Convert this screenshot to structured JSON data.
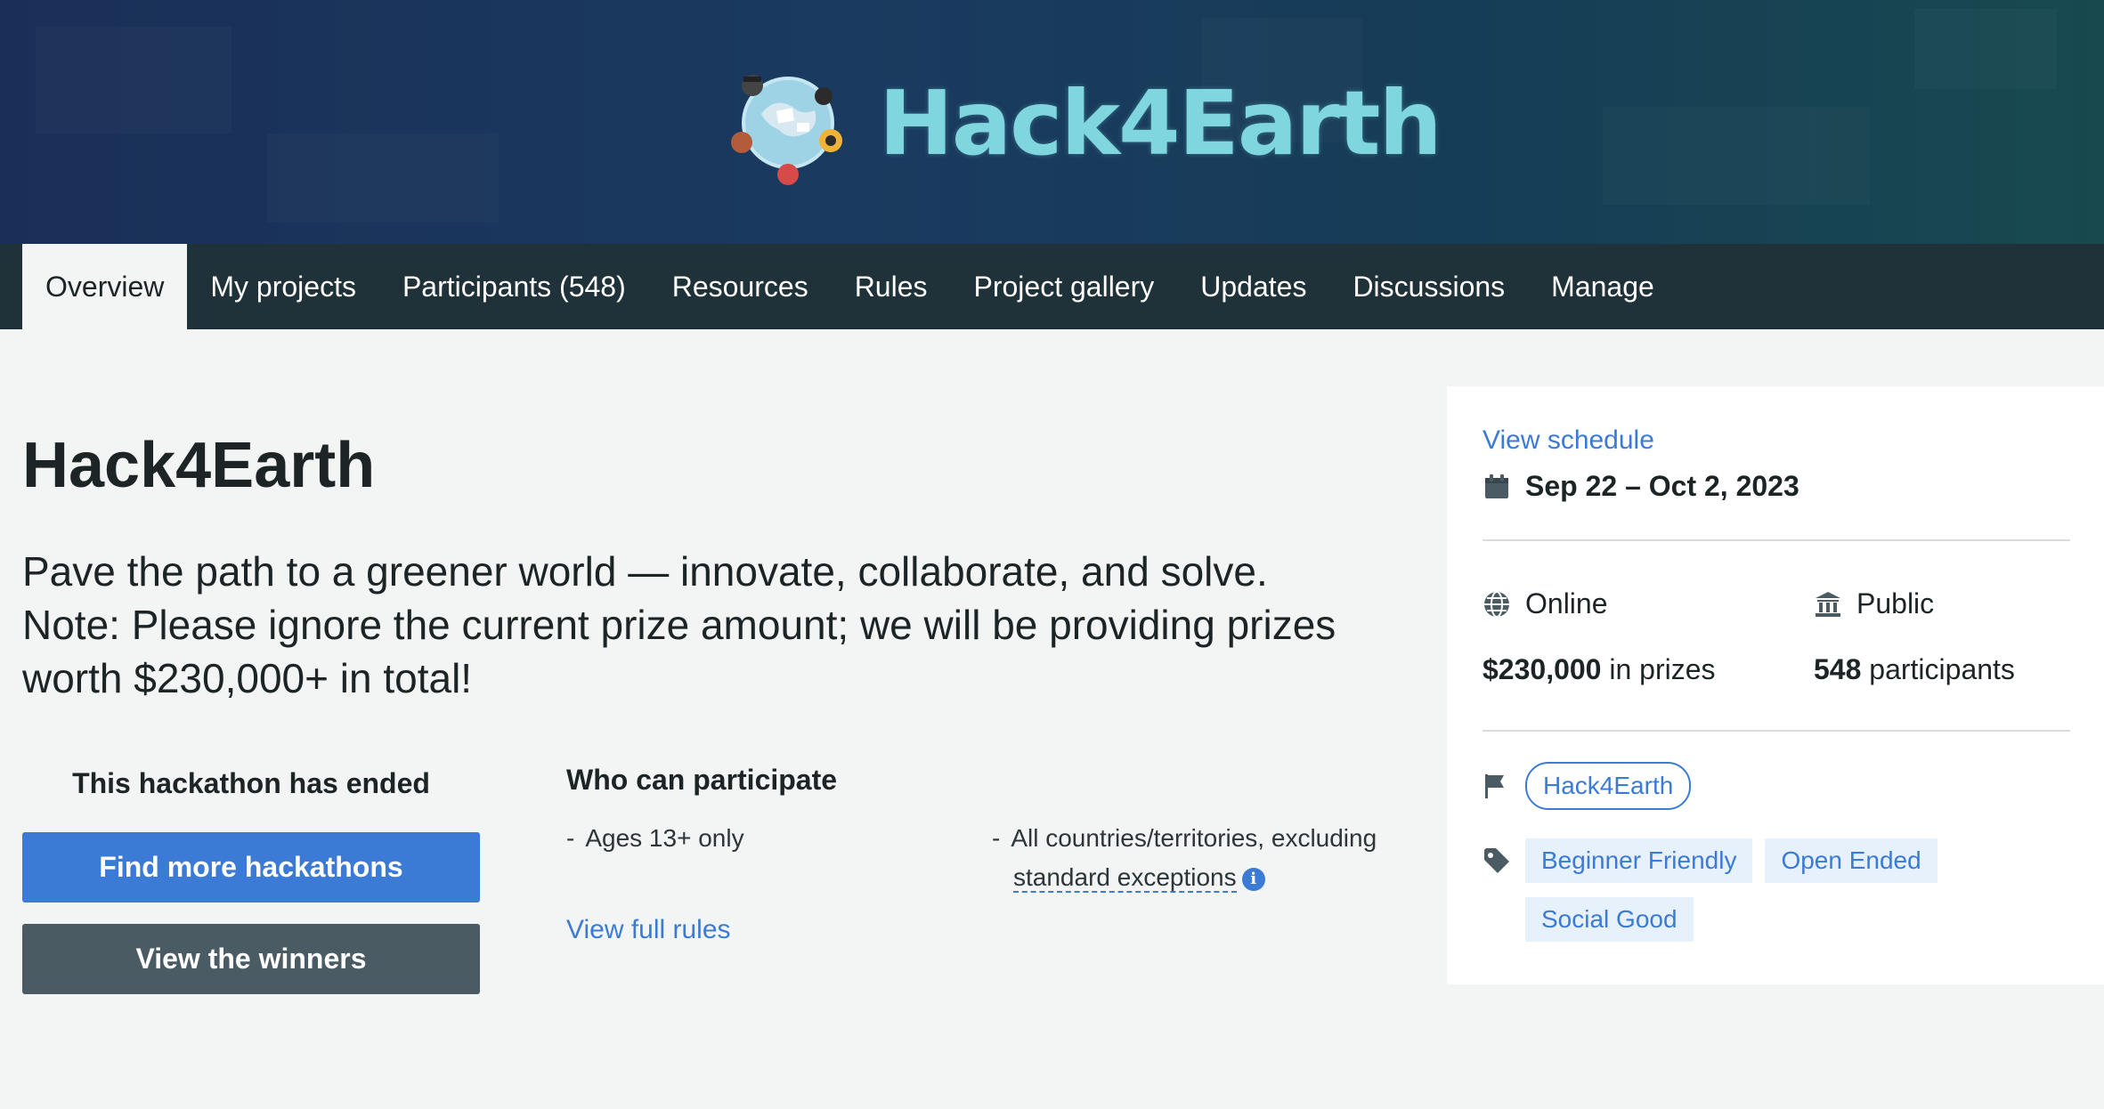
{
  "banner": {
    "logo_text": "Hack4Earth",
    "colors": {
      "background": "#1a3a5f",
      "logo_text": "#7fd6df"
    }
  },
  "nav": {
    "items": [
      {
        "label": "Overview",
        "active": true
      },
      {
        "label": "My projects"
      },
      {
        "label": "Participants (548)"
      },
      {
        "label": "Resources"
      },
      {
        "label": "Rules"
      },
      {
        "label": "Project gallery"
      },
      {
        "label": "Updates"
      },
      {
        "label": "Discussions"
      },
      {
        "label": "Manage"
      }
    ]
  },
  "main": {
    "title": "Hack4Earth",
    "tagline": "Pave the path to a greener world — innovate, collaborate, and solve. Note: Please ignore the current prize amount; we will be providing prizes worth $230,000+ in total!",
    "status": "This hackathon has ended",
    "find_button": "Find more hackathons",
    "winners_button": "View the winners",
    "who_title": "Who can participate",
    "eligibility": {
      "ages": "Ages 13+ only",
      "countries": "All countries/territories, excluding",
      "exceptions": "standard exceptions"
    },
    "rules_link": "View full rules"
  },
  "sidebar": {
    "schedule_link": "View schedule",
    "dates": "Sep 22 – Oct 2, 2023",
    "location": "Online",
    "visibility": "Public",
    "prize_amount": "$230,000",
    "prize_suffix": " in prizes",
    "participant_count": "548",
    "participant_suffix": " participants",
    "host_chip": "Hack4Earth",
    "tags": [
      "Beginner Friendly",
      "Open Ended",
      "Social Good"
    ],
    "colors": {
      "accent": "#3b7bd6",
      "tag_bg": "#e7f1fb"
    }
  }
}
